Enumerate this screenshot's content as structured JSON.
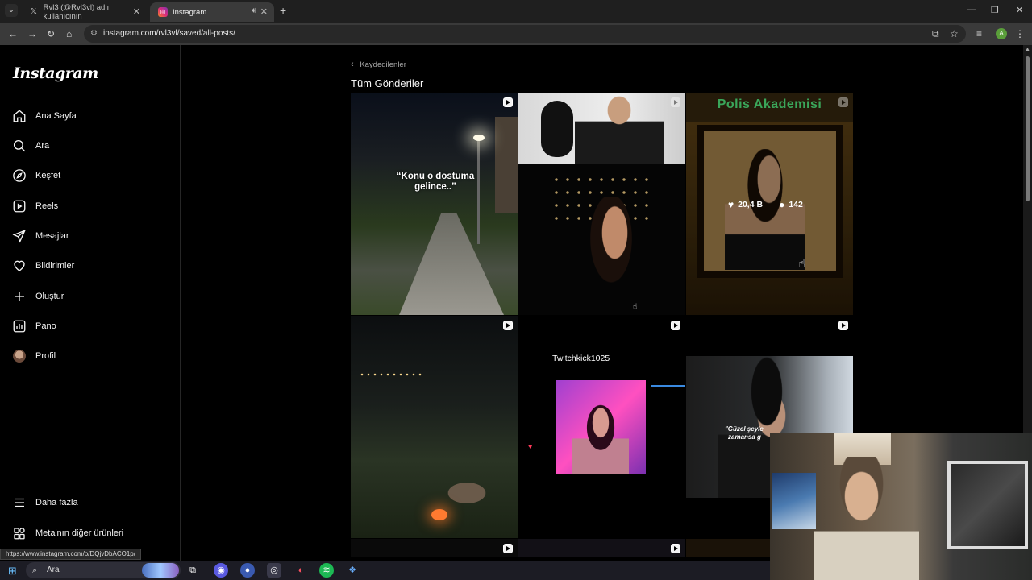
{
  "browser": {
    "tabs": [
      {
        "title": "Rvl3 (@Rvl3vl) adlı kullanıcının",
        "icon": "x-logo-icon"
      },
      {
        "title": "Instagram",
        "icon": "instagram-icon",
        "active": true
      }
    ],
    "url": "instagram.com/rvl3vl/saved/all-posts/",
    "profile_letter": "A"
  },
  "sidebar": {
    "logo": "Instagram",
    "items": [
      {
        "label": "Ana Sayfa",
        "icon": "home-icon"
      },
      {
        "label": "Ara",
        "icon": "search-icon"
      },
      {
        "label": "Keşfet",
        "icon": "compass-icon"
      },
      {
        "label": "Reels",
        "icon": "reels-icon"
      },
      {
        "label": "Mesajlar",
        "icon": "messenger-icon"
      },
      {
        "label": "Bildirimler",
        "icon": "heart-icon"
      },
      {
        "label": "Oluştur",
        "icon": "plus-icon"
      },
      {
        "label": "Pano",
        "icon": "dashboard-icon"
      },
      {
        "label": "Profil",
        "icon": "profile-avatar"
      }
    ],
    "more": "Daha fazla",
    "meta": "Meta'nın diğer ürünleri"
  },
  "main": {
    "back_label": "Kaydedilenler",
    "title": "Tüm Gönderiler",
    "posts": {
      "p1_caption": "“Konu o dostuma gelince..”",
      "p3_banner": "Polis Akademisi",
      "p3_likes": "20,4 B",
      "p3_comments": "142",
      "p5_username": "Twitchkick1025",
      "p6_subtitle_1": "\"Güzel şeyle",
      "p6_subtitle_2": "zamansa g"
    }
  },
  "status_url": "https://www.instagram.com/p/DQjvDbACO1p/",
  "taskbar": {
    "search_placeholder": "Ara"
  }
}
